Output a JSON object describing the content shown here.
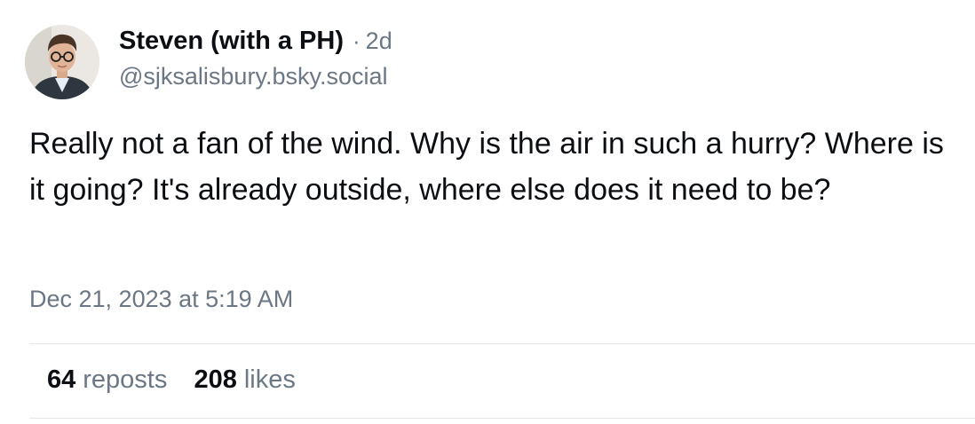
{
  "post": {
    "author": {
      "display_name": "Steven (with a PH)",
      "handle": "@sjksalisbury.bsky.social",
      "avatar_icon": "profile-photo-man-with-glasses"
    },
    "separator": "·",
    "relative_time": "2d",
    "text": "Really not a fan of the wind. Why is the air in such a hurry? Where is it going? It's already outside, where else does it need to be?",
    "timestamp": "Dec 21, 2023 at 5:19 AM",
    "stats": {
      "reposts_count": "64",
      "reposts_label": "reposts",
      "likes_count": "208",
      "likes_label": "likes"
    }
  },
  "colors": {
    "text_primary": "#0b0f14",
    "text_secondary": "#6b7785",
    "divider": "#e3e6ea",
    "background": "#ffffff"
  }
}
